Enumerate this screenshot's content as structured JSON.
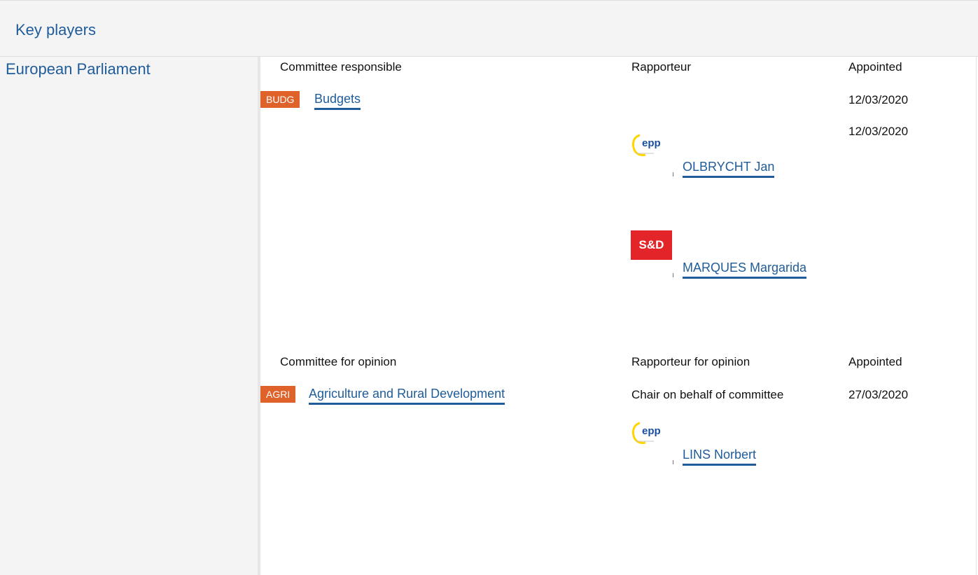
{
  "header": {
    "title": "Key players"
  },
  "institution": {
    "name": "European Parliament"
  },
  "responsible": {
    "col_committee": "Committee responsible",
    "col_rapporteur": "Rapporteur",
    "col_appointed": "Appointed",
    "committee": {
      "code": "BUDG",
      "name": "Budgets"
    },
    "rapporteurs": [
      {
        "group": "epp",
        "name": "OLBRYCHT Jan",
        "appointed": "12/03/2020"
      },
      {
        "group": "S&D",
        "name": "MARQUES Margarida",
        "appointed": "12/03/2020"
      }
    ]
  },
  "opinion": {
    "col_committee": "Committee for opinion",
    "col_rapporteur": "Rapporteur for opinion",
    "col_appointed": "Appointed",
    "committee": {
      "code": "AGRI",
      "name": "Agriculture and Rural Development"
    },
    "chair_note": "Chair on behalf of committee",
    "rapporteurs": [
      {
        "group": "epp",
        "name": "LINS Norbert",
        "appointed": "27/03/2020"
      }
    ]
  }
}
